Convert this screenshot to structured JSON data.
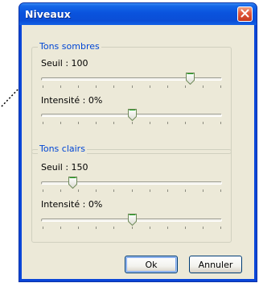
{
  "window": {
    "title": "Niveaux"
  },
  "groups": {
    "sombres": {
      "legend": "Tons sombres",
      "seuil": {
        "label": "Seuil : 100",
        "value": 100,
        "min": 0,
        "max": 120
      },
      "intensite": {
        "label": "Intensité : 0%",
        "value": 0,
        "min": -100,
        "max": 100
      }
    },
    "clairs": {
      "legend": "Tons clairs",
      "seuil": {
        "label": "Seuil : 150",
        "value": 150,
        "min": 130,
        "max": 255
      },
      "intensite": {
        "label": "Intensité : 0%",
        "value": 0,
        "min": -100,
        "max": 100
      }
    }
  },
  "buttons": {
    "ok": "Ok",
    "cancel": "Annuler"
  },
  "icons": {
    "close": "close-icon",
    "slider_thumb": "slider-thumb-icon"
  },
  "colors": {
    "titlebar": "#0a53dd",
    "dialog_bg": "#ece9d8",
    "group_legend": "#0046d5",
    "close_button": "#e0553a"
  }
}
